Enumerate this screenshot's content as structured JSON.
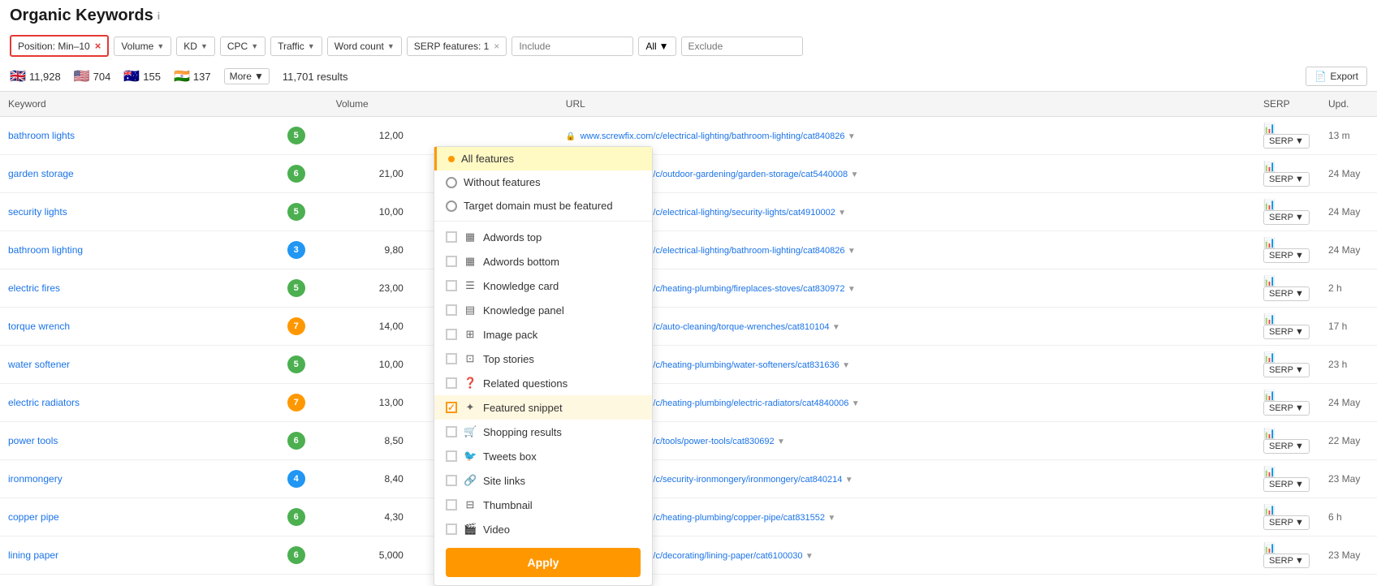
{
  "header": {
    "title": "Organic Keywords",
    "info_label": "i"
  },
  "filters": {
    "position": "Position: Min–10",
    "position_close": "×",
    "volume_label": "Volume",
    "kd_label": "KD",
    "cpc_label": "CPC",
    "traffic_label": "Traffic",
    "wordcount_label": "Word count",
    "serp_label": "SERP features: 1",
    "serp_close": "×",
    "include_placeholder": "Include",
    "all_label": "All",
    "exclude_placeholder": "Exclude"
  },
  "stats": {
    "uk_flag": "🇬🇧",
    "uk_count": "11,928",
    "us_flag": "🇺🇸",
    "us_count": "704",
    "au_flag": "🇦🇺",
    "au_count": "155",
    "in_flag": "🇮🇳",
    "in_count": "137",
    "more_label": "More",
    "results": "11,701 results",
    "export_label": "Export"
  },
  "table": {
    "col_keyword": "Keyword",
    "col_volume": "Volume",
    "col_url": "URL",
    "col_serp": "SERP",
    "col_upd": "Upd.",
    "rows": [
      {
        "keyword": "bathroom lights",
        "pos": "5",
        "pos_color": "pos-green",
        "volume": "12,00",
        "url": "www.screwfix.com/c/electrical-lighting/bathroom-lighting/cat840826",
        "upd": "13 m"
      },
      {
        "keyword": "garden storage",
        "pos": "6",
        "pos_color": "pos-green",
        "volume": "21,00",
        "url": "www.screwfix.com/c/outdoor-gardening/garden-storage/cat5440008",
        "upd": "24 May"
      },
      {
        "keyword": "security lights",
        "pos": "5",
        "pos_color": "pos-green",
        "volume": "10,00",
        "url": "www.screwfix.com/c/electrical-lighting/security-lights/cat4910002",
        "upd": "24 May"
      },
      {
        "keyword": "bathroom lighting",
        "pos": "3",
        "pos_color": "pos-blue",
        "volume": "9,80",
        "url": "www.screwfix.com/c/electrical-lighting/bathroom-lighting/cat840826",
        "upd": "24 May"
      },
      {
        "keyword": "electric fires",
        "pos": "5",
        "pos_color": "pos-green",
        "volume": "23,00",
        "url": "www.screwfix.com/c/heating-plumbing/fireplaces-stoves/cat830972",
        "upd": "2 h"
      },
      {
        "keyword": "torque wrench",
        "pos": "7",
        "pos_color": "pos-orange",
        "volume": "14,00",
        "url": "www.screwfix.com/c/auto-cleaning/torque-wrenches/cat810104",
        "upd": "17 h"
      },
      {
        "keyword": "water softener",
        "pos": "5",
        "pos_color": "pos-green",
        "volume": "10,00",
        "url": "www.screwfix.com/c/heating-plumbing/water-softeners/cat831636",
        "upd": "23 h"
      },
      {
        "keyword": "electric radiators",
        "pos": "7",
        "pos_color": "pos-orange",
        "volume": "13,00",
        "url": "www.screwfix.com/c/heating-plumbing/electric-radiators/cat4840006",
        "upd": "24 May"
      },
      {
        "keyword": "power tools",
        "pos": "6",
        "pos_color": "pos-green",
        "volume": "8,50",
        "url": "www.screwfix.com/c/tools/power-tools/cat830692",
        "upd": "22 May"
      },
      {
        "keyword": "ironmongery",
        "pos": "4",
        "pos_color": "pos-blue",
        "volume": "8,40",
        "url": "www.screwfix.com/c/security-ironmongery/ironmongery/cat840214",
        "upd": "23 May"
      },
      {
        "keyword": "copper pipe",
        "pos": "6",
        "pos_color": "pos-green",
        "volume": "4,30",
        "url": "www.screwfix.com/c/heating-plumbing/copper-pipe/cat831552",
        "upd": "6 h"
      },
      {
        "keyword": "lining paper",
        "pos": "6",
        "pos_color": "pos-green",
        "volume": "5,000",
        "url": "www.screwfix.com/c/decorating/lining-paper/cat6100030",
        "upd": "23 May"
      }
    ]
  },
  "dropdown": {
    "all_features_label": "All features",
    "without_features_label": "Without features",
    "target_domain_label": "Target domain must be featured",
    "items": [
      {
        "label": "Adwords top",
        "icon": "▦",
        "checked": false
      },
      {
        "label": "Adwords bottom",
        "icon": "▦",
        "checked": false
      },
      {
        "label": "Knowledge card",
        "icon": "☰",
        "checked": false
      },
      {
        "label": "Knowledge panel",
        "icon": "▤",
        "checked": false
      },
      {
        "label": "Image pack",
        "icon": "⊞",
        "checked": false
      },
      {
        "label": "Top stories",
        "icon": "⊡",
        "checked": false
      },
      {
        "label": "Related questions",
        "icon": "❓",
        "checked": false
      },
      {
        "label": "Featured snippet",
        "icon": "✦",
        "checked": true
      },
      {
        "label": "Shopping results",
        "icon": "🛒",
        "checked": false
      },
      {
        "label": "Tweets box",
        "icon": "🐦",
        "checked": false
      },
      {
        "label": "Site links",
        "icon": "🔗",
        "checked": false
      },
      {
        "label": "Thumbnail",
        "icon": "⊟",
        "checked": false
      },
      {
        "label": "Video",
        "icon": "🎬",
        "checked": false
      }
    ],
    "apply_label": "Apply"
  }
}
